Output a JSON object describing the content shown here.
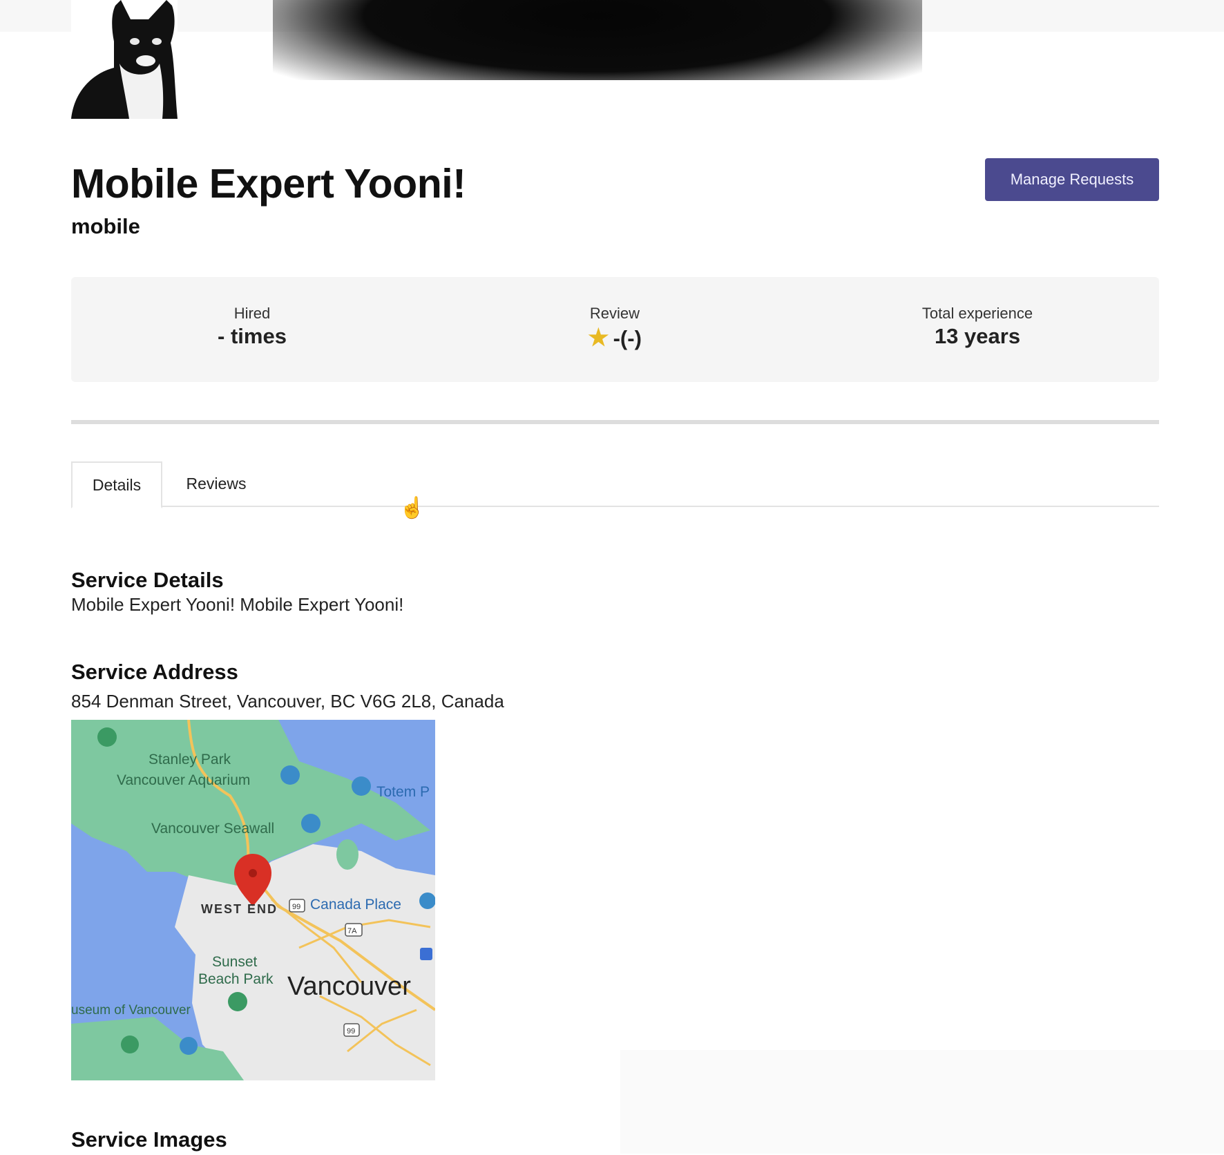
{
  "profile": {
    "title": "Mobile Expert Yooni!",
    "category": "mobile",
    "manage_button_label": "Manage Requests"
  },
  "stats": {
    "hired": {
      "label": "Hired",
      "value": "- times"
    },
    "review": {
      "label": "Review",
      "value": "-(-)",
      "icon": "star-icon"
    },
    "experience": {
      "label": "Total experience",
      "value": "13 years"
    }
  },
  "tabs": [
    {
      "label": "Details",
      "active": true
    },
    {
      "label": "Reviews",
      "active": false
    }
  ],
  "service_details": {
    "heading": "Service Details",
    "text": "Mobile Expert Yooni! Mobile Expert Yooni!"
  },
  "service_address": {
    "heading": "Service Address",
    "text": "854 Denman Street, Vancouver, BC V6G 2L8, Canada"
  },
  "map": {
    "labels": {
      "stanley_park": "Stanley Park",
      "aquarium": "Vancouver Aquarium",
      "totem": "Totem P",
      "seawall": "Vancouver Seawall",
      "west_end": "WEST END",
      "canada_place": "Canada Place",
      "sunset_beach": "Sunset",
      "sunset_beach_2": "Beach Park",
      "vancouver": "Vancouver",
      "museum": "useum of Vancouver",
      "route_99": "99",
      "route_7a": "7A"
    },
    "colors": {
      "water": "#7ea4ea",
      "park": "#7ec8a0",
      "city": "#e9e9e9",
      "road": "#f3c35a",
      "pin": "#d93025"
    }
  },
  "service_images": {
    "heading": "Service Images"
  }
}
